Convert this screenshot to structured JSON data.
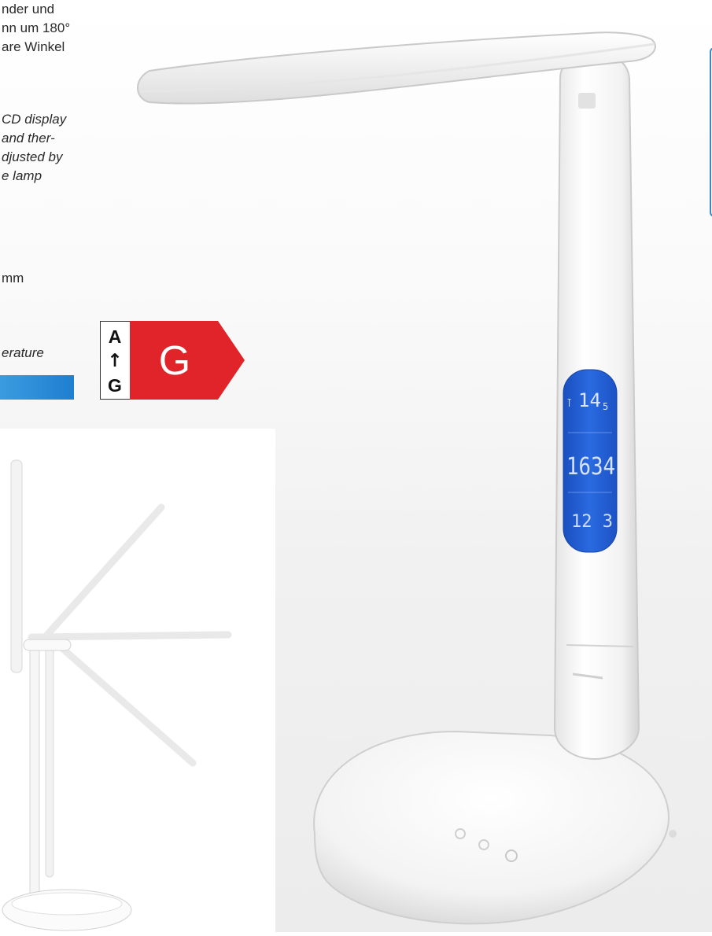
{
  "text": {
    "german": [
      "nder und",
      "nn um 180°",
      "are Winkel"
    ],
    "english": [
      "CD display",
      "and ther-",
      "djusted by",
      "e lamp"
    ],
    "dimension": "mm",
    "temperature": "erature"
  },
  "energy_label": {
    "scale_top": "A",
    "scale_arrow": "↑",
    "scale_bottom": "G",
    "class": "G",
    "color": "#e0242a"
  },
  "lcd": {
    "temperature": "14",
    "temperature_decimal": "5",
    "time": "1634",
    "date": "12  3",
    "color": "#1f5fcf"
  }
}
